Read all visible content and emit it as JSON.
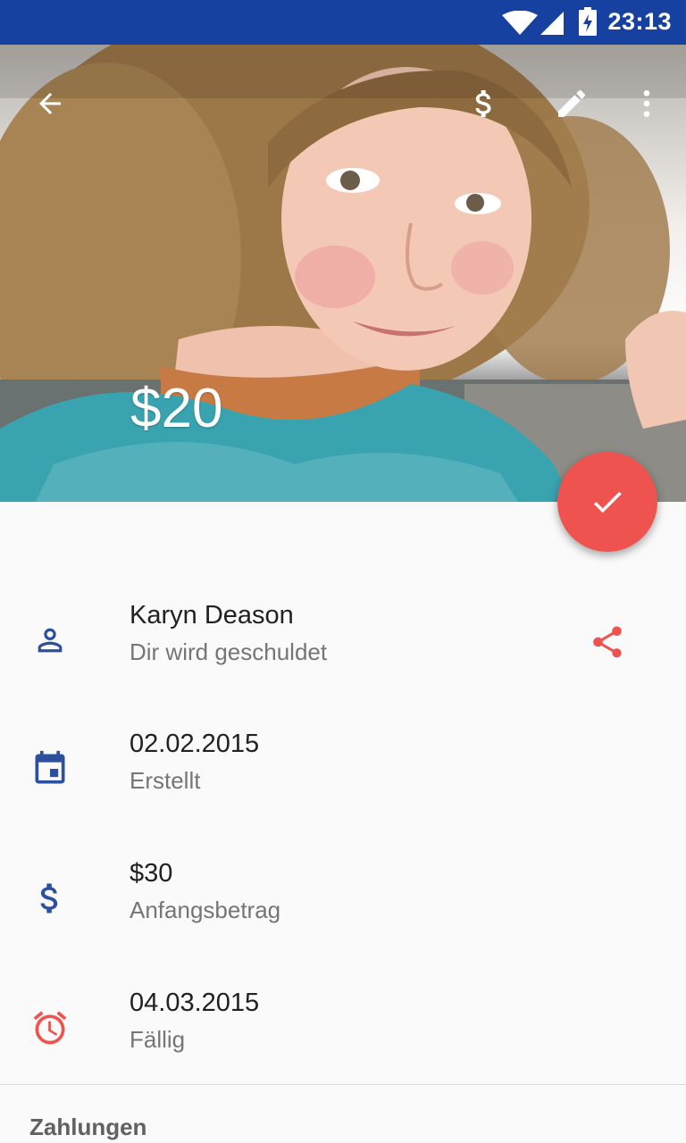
{
  "status_bar": {
    "time": "23:13",
    "icons": [
      "wifi-icon",
      "signal-icon",
      "battery-charging-icon"
    ]
  },
  "toolbar": {
    "back_icon": "arrow-back-icon",
    "actions": [
      "dollar-icon",
      "edit-pencil-icon",
      "more-vert-icon"
    ]
  },
  "hero": {
    "amount": "$20"
  },
  "fab": {
    "icon": "check-icon",
    "color": "#ef5350"
  },
  "details": [
    {
      "icon": "person-icon",
      "primary": "Karyn Deason",
      "secondary": "Dir wird geschuldet",
      "trailing_icon": "share-icon"
    },
    {
      "icon": "calendar-icon",
      "primary": "02.02.2015",
      "secondary": "Erstellt"
    },
    {
      "icon": "dollar-icon",
      "primary": "$30",
      "secondary": "Anfangsbetrag"
    },
    {
      "icon": "alarm-icon",
      "primary": "04.03.2015",
      "secondary": "Fällig"
    }
  ],
  "payments_section": {
    "title": "Zahlungen"
  },
  "colors": {
    "primary": "#1741a0",
    "icon_blue": "#2c4f9e",
    "accent": "#ef5350"
  }
}
